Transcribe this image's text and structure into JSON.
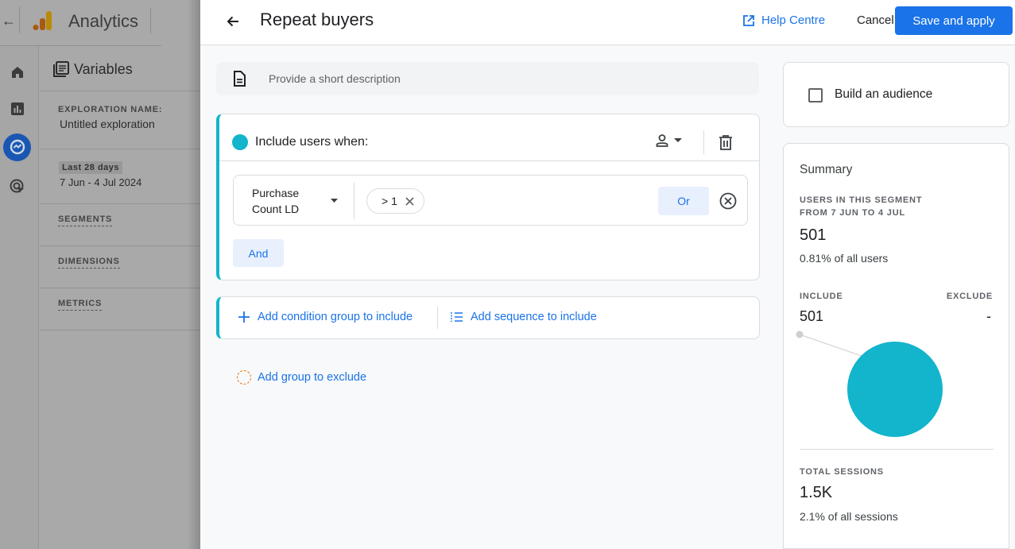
{
  "app": {
    "name": "Analytics",
    "nav_rail": [
      {
        "icon": "home-icon",
        "label": "Home"
      },
      {
        "icon": "reports-icon",
        "label": "Reports"
      },
      {
        "icon": "explore-icon",
        "label": "Explore",
        "active": true
      },
      {
        "icon": "advertising-icon",
        "label": "Advertising"
      }
    ],
    "variables_panel": {
      "title": "Variables",
      "exploration_name_label": "EXPLORATION NAME:",
      "exploration_name": "Untitled exploration",
      "date_chip": "Last 28 days",
      "date_range": "7 Jun - 4 Jul 2024",
      "sections": [
        "SEGMENTS",
        "DIMENSIONS",
        "METRICS"
      ]
    }
  },
  "segment_editor": {
    "title": "Repeat buyers",
    "help_label": "Help Centre",
    "cancel_label": "Cancel",
    "save_label": "Save and apply",
    "description_placeholder": "Provide a short description",
    "include_group": {
      "title": "Include users when:",
      "scope": "user",
      "condition": {
        "dimension": "Purchase Count LD",
        "dimension_line1": "Purchase",
        "dimension_line2": "Count LD",
        "filter_chip": "> 1"
      },
      "or_label": "Or",
      "and_label": "And"
    },
    "add_condition_group_label": "Add condition group to include",
    "add_sequence_label": "Add sequence to include",
    "add_exclude_label": "Add group to exclude"
  },
  "side_panel": {
    "build_audience_label": "Build an audience",
    "build_audience_checked": false,
    "summary": {
      "title": "Summary",
      "users_caption_line1": "USERS IN THIS SEGMENT",
      "users_caption_line2": "FROM 7 JUN TO 4 JUL",
      "users_value": "501",
      "users_share": "0.81% of all users",
      "include_label": "INCLUDE",
      "exclude_label": "EXCLUDE",
      "include_value": "501",
      "exclude_value": "-",
      "sessions_caption": "TOTAL SESSIONS",
      "sessions_value": "1.5K",
      "sessions_share": "2.1% of all sessions"
    }
  },
  "colors": {
    "accent": "#1a73e8",
    "segment_include": "#12b5cb",
    "exclude_outline": "#e8710a"
  },
  "chart_data": {
    "type": "pie",
    "title": "",
    "categories": [
      "Include",
      "Exclude"
    ],
    "values": [
      501,
      0
    ],
    "colors": [
      "#12b5cb",
      "#dadce0"
    ],
    "labels": {
      "Include": "501",
      "Exclude": "-"
    }
  }
}
